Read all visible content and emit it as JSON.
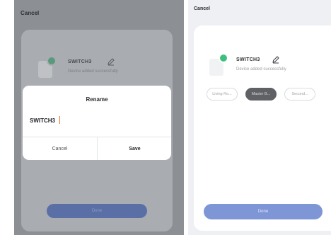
{
  "left_screen": {
    "top_cancel": "Cancel",
    "device": {
      "name": "SWITCH3",
      "status": "Device added successfully"
    },
    "done_label": "Done",
    "rename_dialog": {
      "title": "Rename",
      "value": "SWITCH3",
      "cancel_label": "Cancel",
      "save_label": "Save"
    }
  },
  "right_screen": {
    "top_cancel": "Cancel",
    "device": {
      "name": "SWITCH3",
      "status": "Device added successfully"
    },
    "rooms": [
      {
        "label": "Living Ro...",
        "selected": false
      },
      {
        "label": "Master B...",
        "selected": true
      },
      {
        "label": "Second...",
        "selected": false
      }
    ],
    "done_label": "Done"
  },
  "colors": {
    "success_dot": "#3fbf7f",
    "primary_button": "#7f96d6",
    "selected_chip": "#5f6165"
  }
}
